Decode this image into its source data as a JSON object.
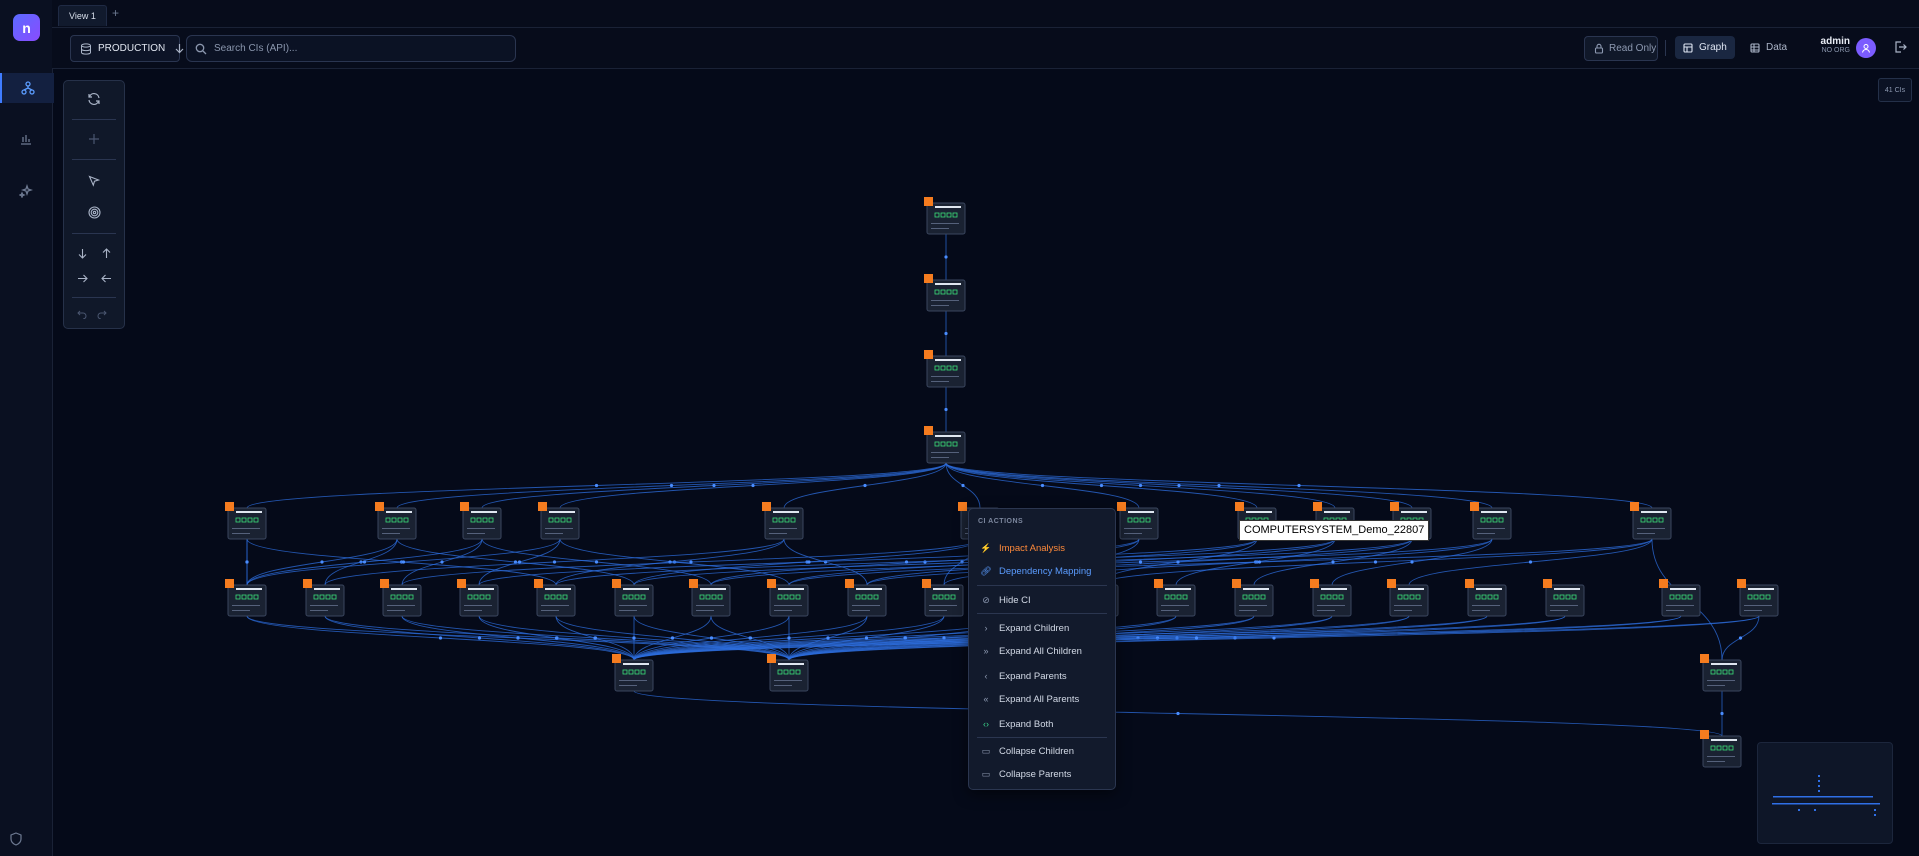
{
  "app": {
    "logo_text": "n"
  },
  "tabs": [
    {
      "label": "View 1"
    }
  ],
  "tab_add": "+",
  "topbar": {
    "environment": "PRODUCTION",
    "search_placeholder": "Search CIs (API)...",
    "read_only_label": "Read Only",
    "graph_label": "Graph",
    "data_label": "Data",
    "user_name": "admin",
    "user_org": "NO ORG"
  },
  "canvas": {
    "ci_count": "41 CIs"
  },
  "context_menu": {
    "header": "CI ACTIONS",
    "items": [
      {
        "label": "Impact Analysis",
        "icon": "bolt-icon"
      },
      {
        "label": "Dependency Mapping",
        "icon": "link-icon"
      },
      {
        "label": "Hide CI",
        "icon": "eye-off-icon"
      },
      {
        "label": "Expand Children",
        "icon": "chevron-right-icon"
      },
      {
        "label": "Expand All Children",
        "icon": "double-chevron-right-icon"
      },
      {
        "label": "Expand Parents",
        "icon": "chevron-left-icon"
      },
      {
        "label": "Expand All Parents",
        "icon": "double-chevron-left-icon"
      },
      {
        "label": "Expand Both",
        "icon": "code-brackets-icon"
      },
      {
        "label": "Collapse Children",
        "icon": "folder-icon"
      },
      {
        "label": "Collapse Parents",
        "icon": "folder-icon"
      }
    ]
  },
  "tooltip": "COMPUTERSYSTEM_Demo_22807",
  "colors": {
    "accent": "#3f7cff",
    "node_tag": "#f57c1f",
    "impact": "#ff8a3a",
    "dependency": "#5b9cff",
    "edge": "#2d6fe0"
  }
}
